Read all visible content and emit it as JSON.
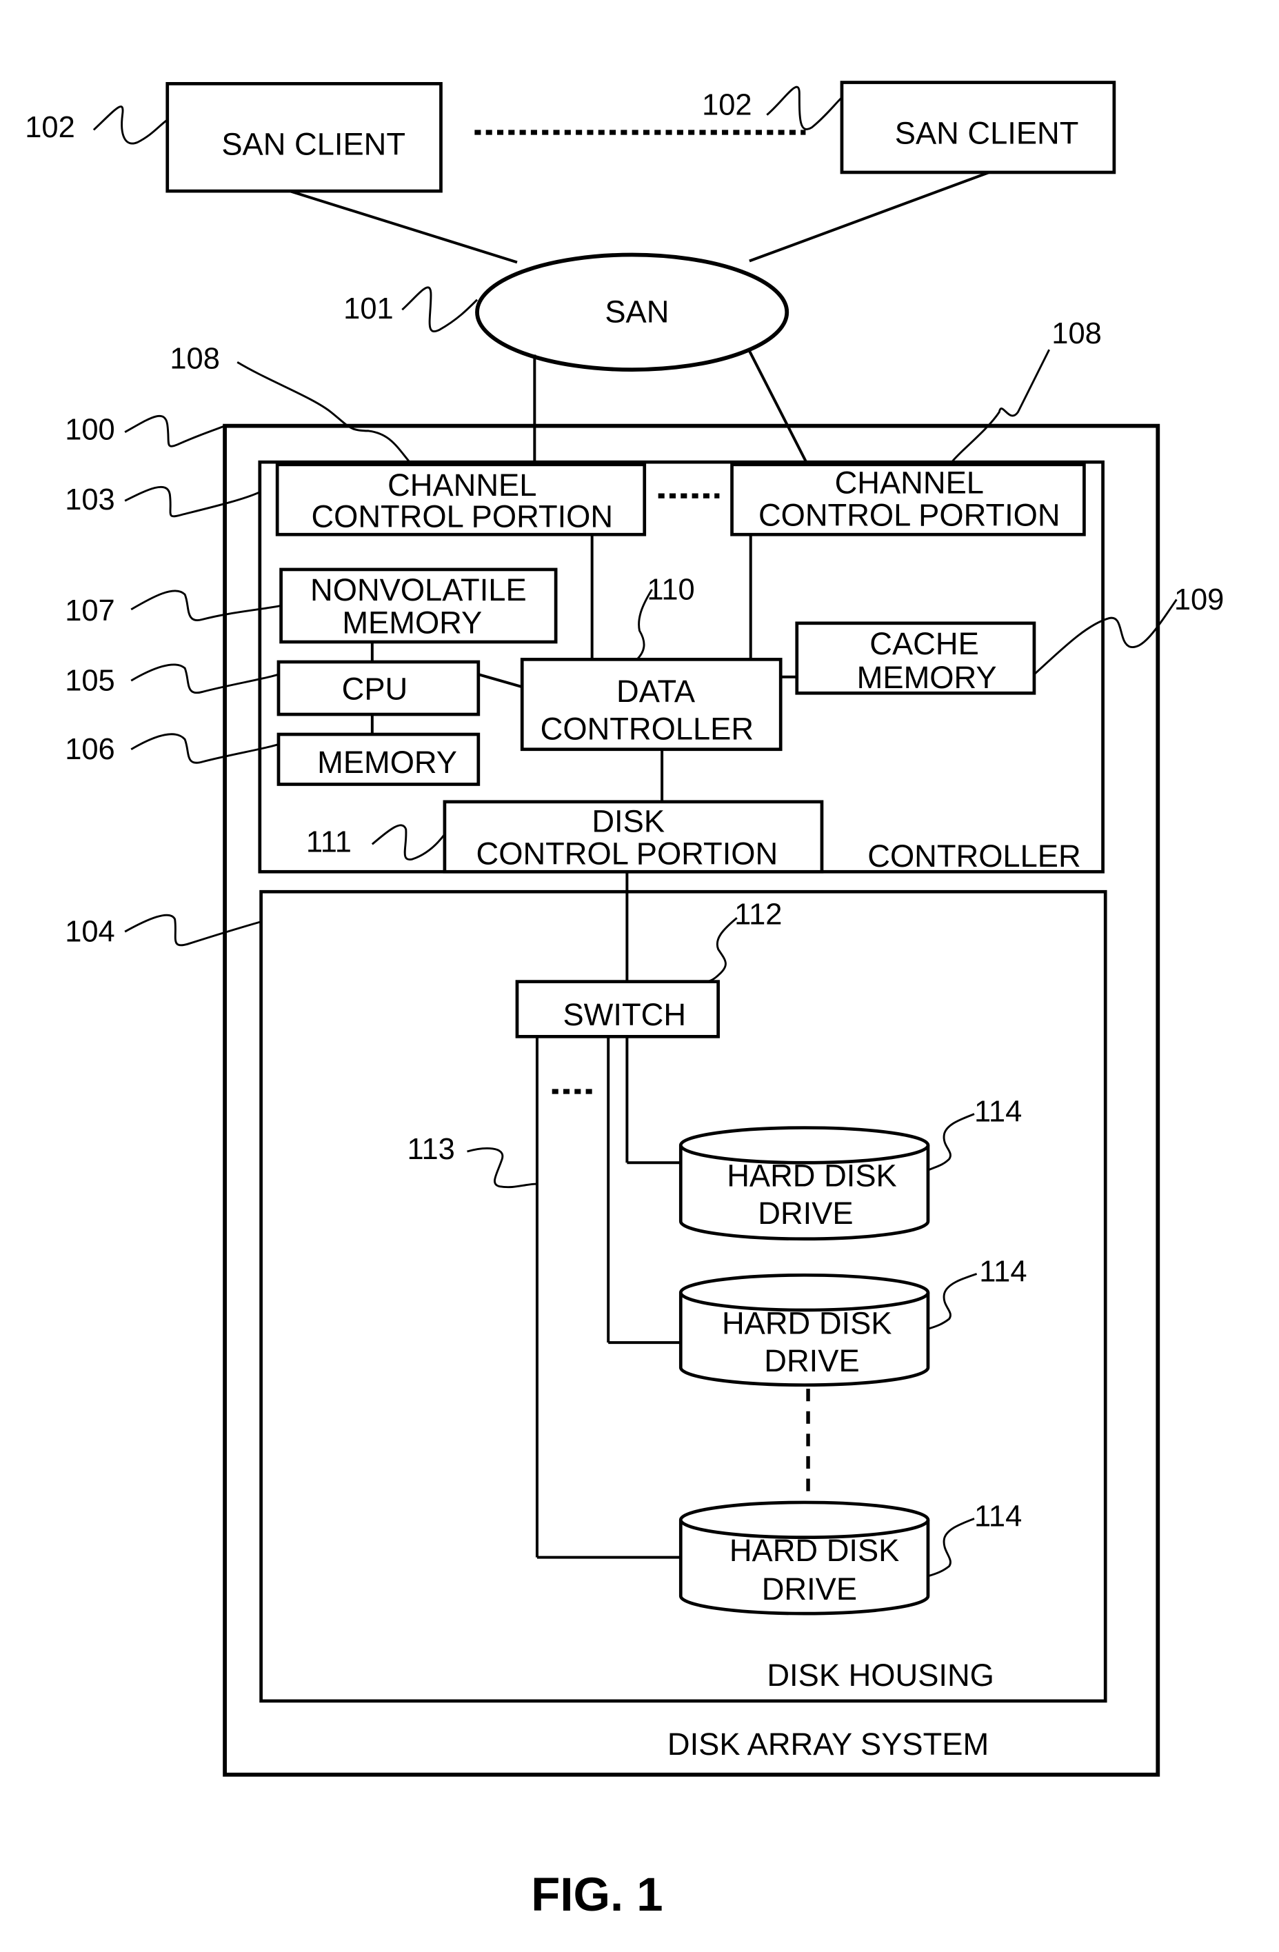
{
  "figure": {
    "caption": "FIG. 1",
    "san_clients": [
      {
        "label": "SAN CLIENT",
        "ref": "102"
      },
      {
        "label": "SAN CLIENT",
        "ref": "102"
      }
    ],
    "san": {
      "label": "SAN",
      "ref": "101"
    },
    "disk_array_system": {
      "label": "DISK ARRAY SYSTEM",
      "ref": "100"
    },
    "controller": {
      "label": "CONTROLLER",
      "ref": "103",
      "channel_control_portions": [
        {
          "line1": "CHANNEL",
          "line2": "CONTROL PORTION",
          "ref": "108"
        },
        {
          "line1": "CHANNEL",
          "line2": "CONTROL PORTION",
          "ref": "108"
        }
      ],
      "nonvolatile_memory": {
        "line1": "NONVOLATILE",
        "line2": "MEMORY",
        "ref": "107"
      },
      "cpu": {
        "label": "CPU",
        "ref": "105"
      },
      "memory": {
        "label": "MEMORY",
        "ref": "106"
      },
      "data_controller": {
        "line1": "DATA",
        "line2": "CONTROLLER",
        "ref": "110"
      },
      "cache_memory": {
        "line1": "CACHE",
        "line2": "MEMORY",
        "ref": "109"
      },
      "disk_control_portion": {
        "line1": "DISK",
        "line2": "CONTROL PORTION",
        "ref": "111"
      }
    },
    "disk_housing": {
      "label": "DISK HOUSING",
      "ref": "104",
      "switch": {
        "label": "SWITCH",
        "ref": "112"
      },
      "path_ref": "113",
      "hard_disk_drives": [
        {
          "line1": "HARD DISK",
          "line2": "DRIVE",
          "ref": "114"
        },
        {
          "line1": "HARD DISK",
          "line2": "DRIVE",
          "ref": "114"
        },
        {
          "line1": "HARD DISK",
          "line2": "DRIVE",
          "ref": "114"
        }
      ]
    }
  }
}
